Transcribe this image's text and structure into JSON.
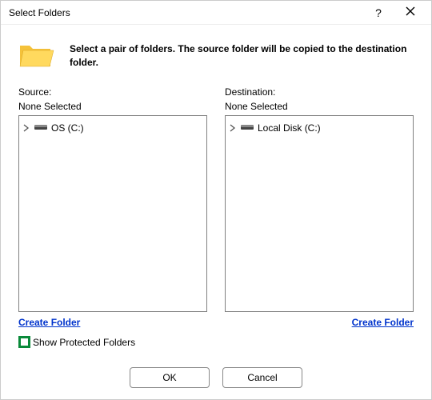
{
  "titlebar": {
    "title": "Select Folders",
    "help": "?",
    "close": "✕"
  },
  "intro": {
    "text": "Select a pair of folders.  The source folder will be copied to the destination folder."
  },
  "source": {
    "label": "Source:",
    "status": "None Selected",
    "root_label": "OS (C:)",
    "create_link": "Create Folder"
  },
  "destination": {
    "label": "Destination:",
    "status": "None Selected",
    "root_label": "Local Disk (C:)",
    "create_link": "Create Folder"
  },
  "protected": {
    "label": "Show Protected Folders"
  },
  "buttons": {
    "ok": "OK",
    "cancel": "Cancel"
  },
  "colors": {
    "accent_green": "#0a8a3a",
    "link_blue": "#0033cc",
    "folder_yellow": "#f5c23a",
    "folder_shadow": "#d9a521"
  }
}
